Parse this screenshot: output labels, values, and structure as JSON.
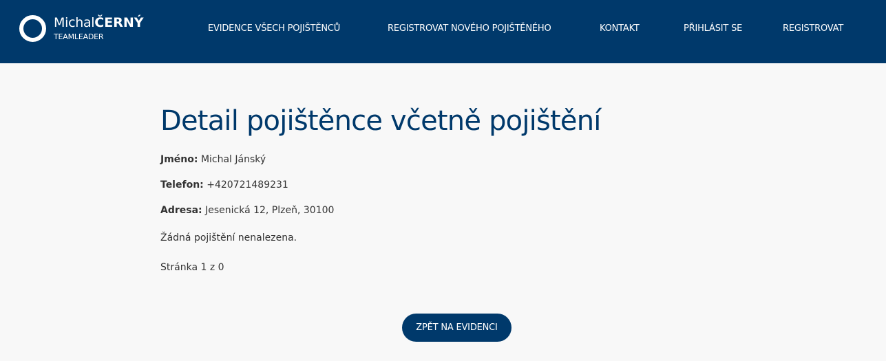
{
  "brand": {
    "first_name": "Michal",
    "last_name": "ČERNÝ",
    "subtitle": "TEAMLEADER"
  },
  "nav": {
    "items": [
      {
        "label": "EVIDENCE VŠECH POJIŠTĚNCŮ"
      },
      {
        "label": "REGISTROVAT NOVÉHO POJIŠTĚNÉHO"
      },
      {
        "label": "KONTAKT"
      },
      {
        "label": "PŘIHLÁSIT SE"
      },
      {
        "label": "REGISTROVAT"
      }
    ]
  },
  "detail": {
    "title": "Detail pojištěnce včetně pojištění",
    "name_label": "Jméno:",
    "name_value": "Michal Jánský",
    "phone_label": "Telefon:",
    "phone_value": "+420721489231",
    "address_label": "Adresa:",
    "address_value": "Jesenická 12, Plzeň, 30100",
    "empty_message": "Žádná pojištění nenalezena.",
    "pagination": "Stránka 1 z 0"
  },
  "actions": {
    "back_label": "ZPĚT NA EVIDENCI"
  },
  "colors": {
    "primary": "#00396b",
    "background": "#f8f8f8",
    "text": "#333333"
  }
}
